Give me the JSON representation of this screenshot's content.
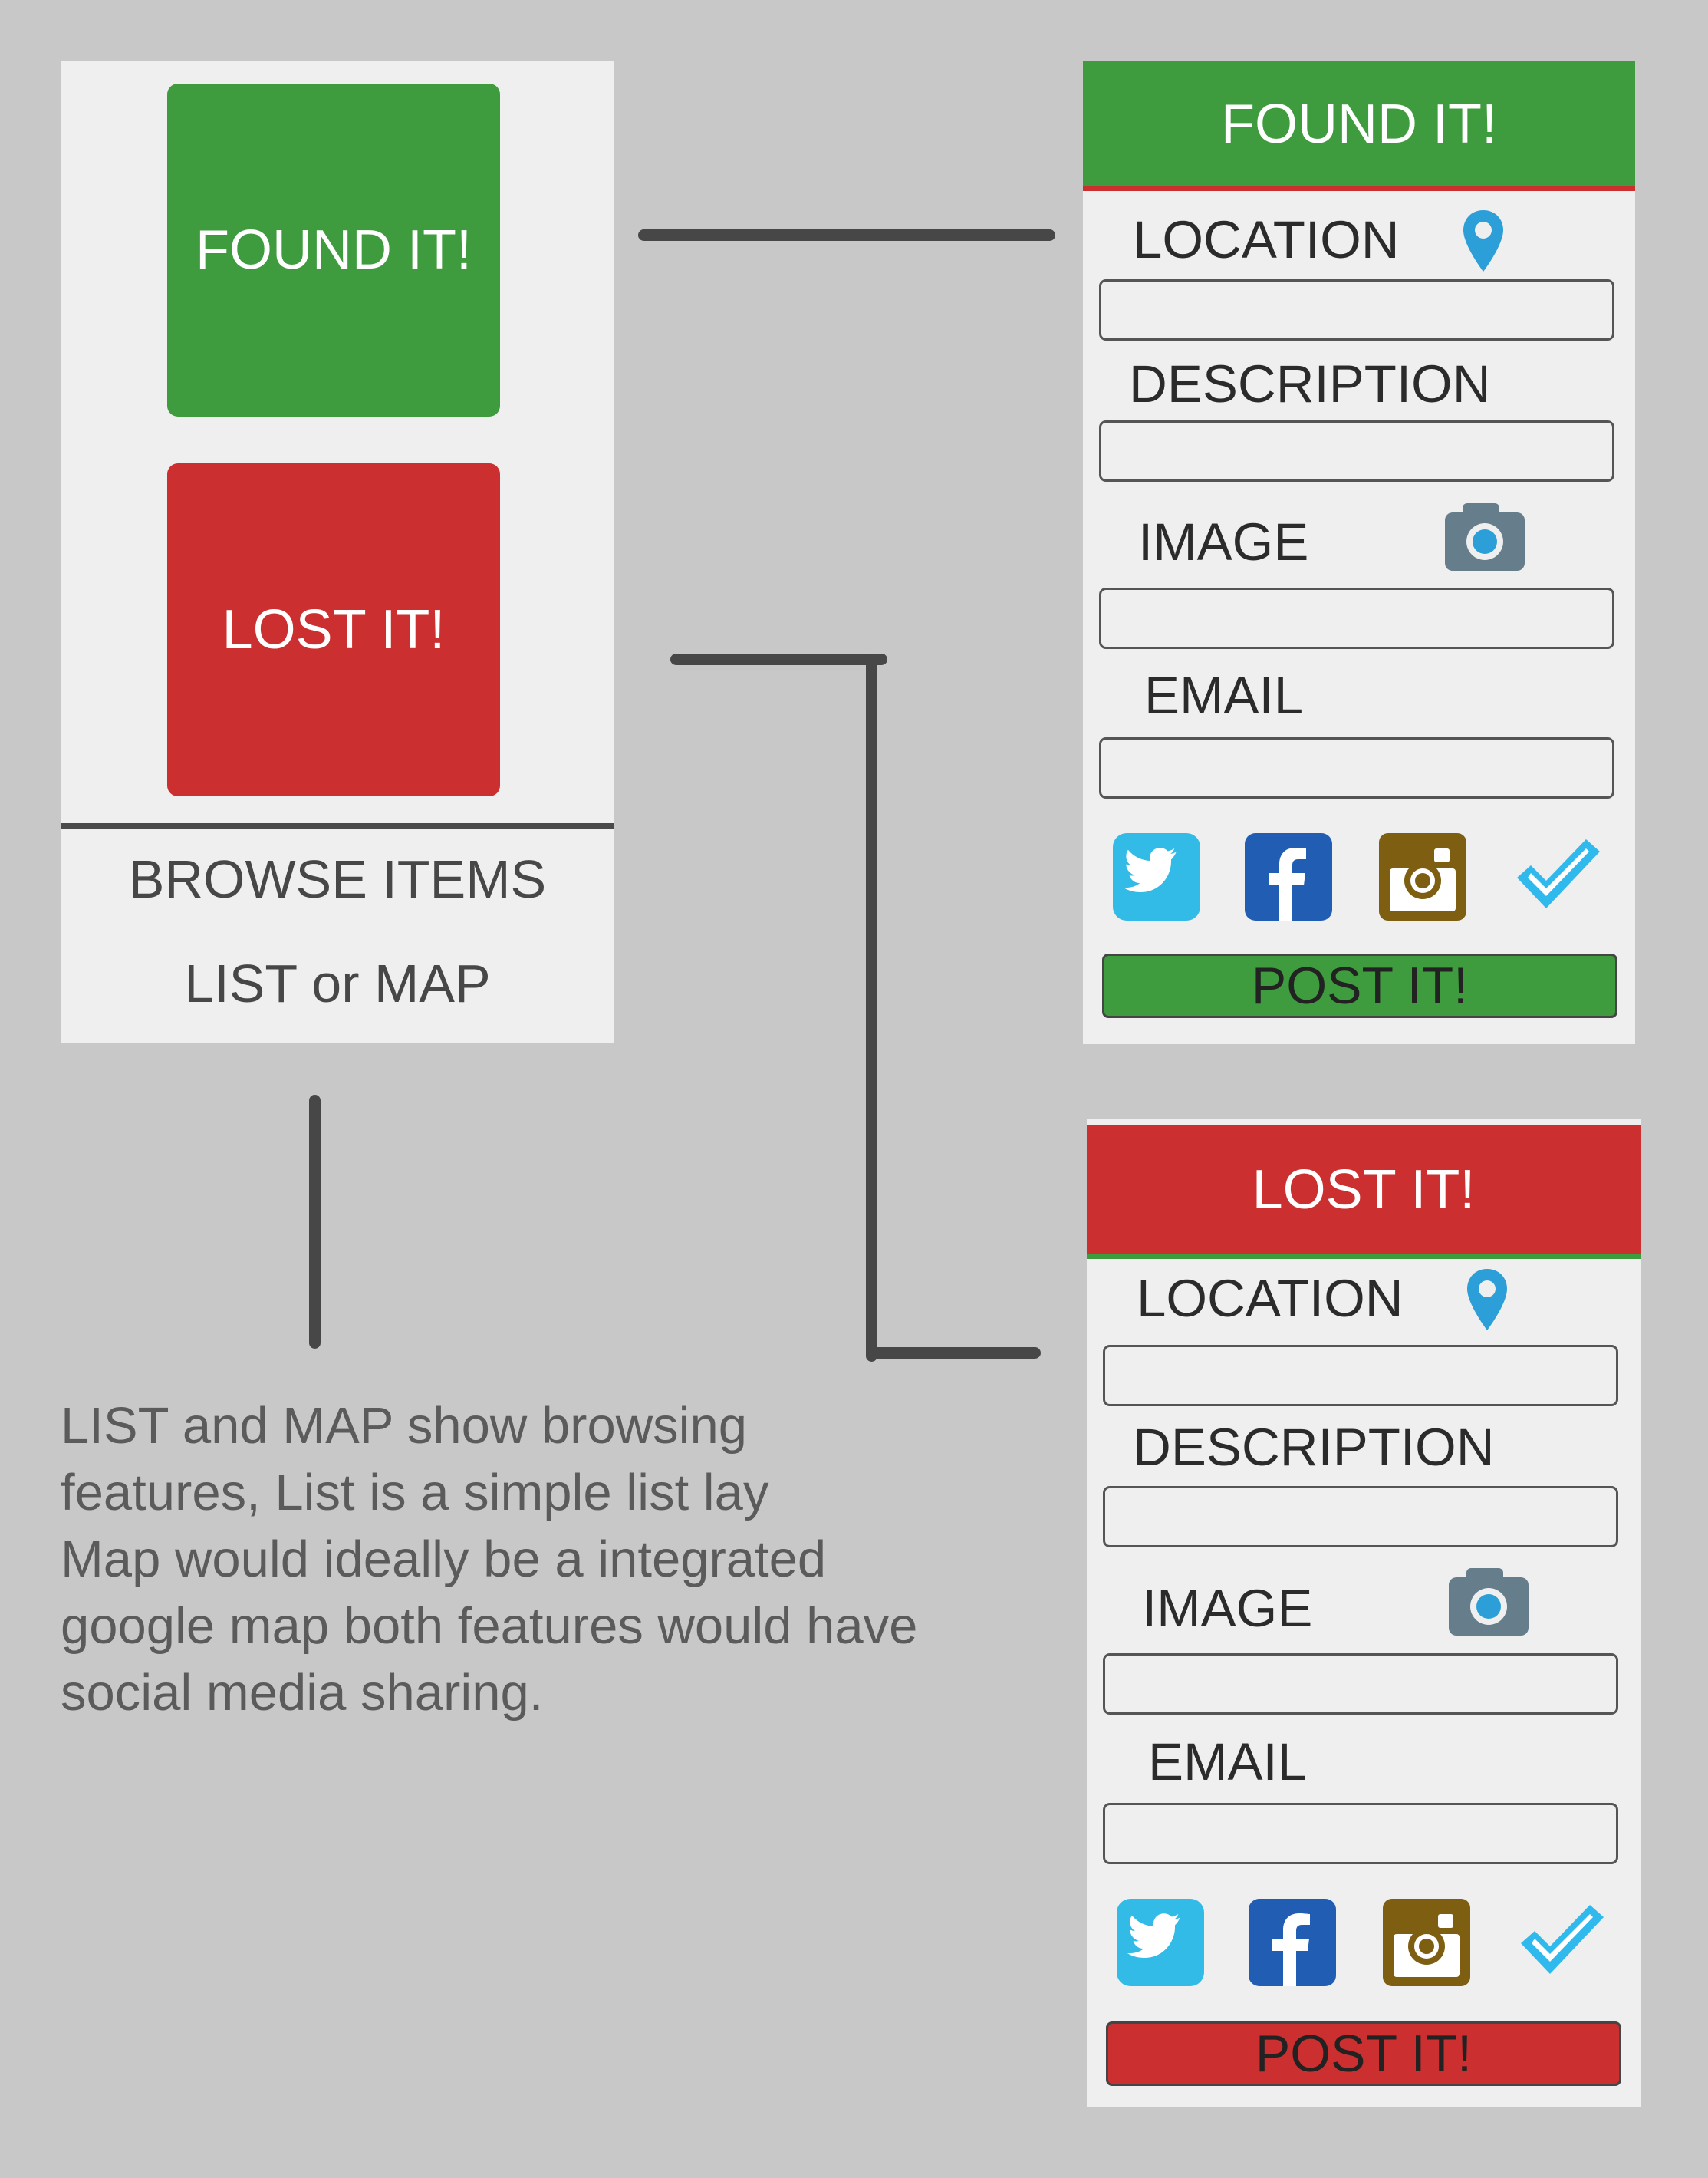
{
  "home": {
    "found_label": "FOUND IT!",
    "lost_label": "LOST IT!",
    "browse_label": "BROWSE ITEMS",
    "list_map_label": "LIST or MAP"
  },
  "note_lines": [
    "LIST and MAP show browsing",
    "features, List is a simple list lay",
    "Map would ideally be a integrated",
    "google map both features would have",
    "social media sharing."
  ],
  "found_form": {
    "title": "FOUND IT!",
    "location_label": "LOCATION",
    "description_label": "DESCRIPTION",
    "image_label": "IMAGE",
    "email_label": "EMAIL",
    "post_label": "POST IT!",
    "location_value": "",
    "description_value": "",
    "image_value": "",
    "email_value": ""
  },
  "lost_form": {
    "title": "LOST IT!",
    "location_label": "LOCATION",
    "description_label": "DESCRIPTION",
    "image_label": "IMAGE",
    "email_label": "EMAIL",
    "post_label": "POST IT!",
    "location_value": "",
    "description_value": "",
    "image_value": "",
    "email_value": ""
  },
  "social_icons": [
    "twitter-icon",
    "facebook-icon",
    "instagram-icon",
    "foursquare-icon"
  ],
  "colors": {
    "background": "#c8c8c8",
    "panel": "#efefef",
    "green": "#3e9b3e",
    "red": "#cb2f2f",
    "connector": "#474747",
    "pin": "#2c9fd8",
    "camera": "#667e8c",
    "twitter": "#33bbe7",
    "facebook": "#215eb3",
    "instagram": "#7e5e11",
    "foursquare": "#30b9ec"
  }
}
